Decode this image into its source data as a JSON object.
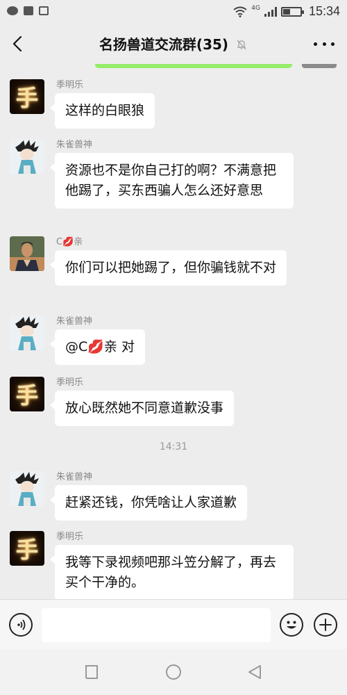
{
  "status_bar": {
    "network": "4G",
    "battery_level": 0.4,
    "time": "15:34",
    "left_icons": [
      "wechat-icon",
      "gallery-icon",
      "picture-icon"
    ]
  },
  "header": {
    "title": "名扬兽道交流群(35)",
    "back_icon": "chevron-left-icon",
    "mute_icon": "bell-off-icon",
    "more_icon": "more-dots-icon"
  },
  "messages": [
    {
      "sender": "季明乐",
      "avatar_char": "手",
      "text": "这样的白眼狼"
    },
    {
      "sender": "朱雀兽神",
      "text": "资源也不是你自己打的啊？不满意把他踢了，买东西骗人怎么还好意思"
    },
    {
      "sender": "C💋亲",
      "text": "你们可以把她踢了，但你骗钱就不对"
    },
    {
      "sender": "朱雀兽神",
      "text": "@C💋亲  对"
    },
    {
      "sender": "季明乐",
      "avatar_char": "手",
      "text": "放心既然她不同意道歉没事"
    },
    {
      "sender": "朱雀兽神",
      "text": "赶紧还钱，你凭啥让人家道歉"
    },
    {
      "sender": "季明乐",
      "avatar_char": "手",
      "text": "我等下录视频吧那斗笠分解了，再去买个干净的。"
    }
  ],
  "timestamp": "14:31",
  "input": {
    "value": "",
    "placeholder": ""
  },
  "colors": {
    "background": "#ededed",
    "bubble": "#ffffff",
    "self_bubble": "#95ec69",
    "sender_name": "#888888"
  }
}
